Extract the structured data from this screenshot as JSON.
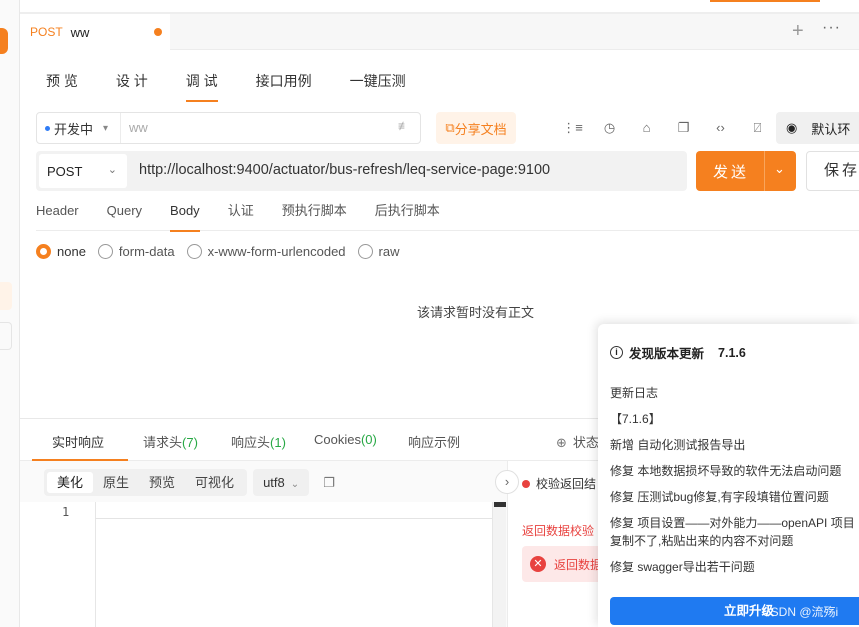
{
  "request_tab": {
    "method": "POST",
    "name": "ww"
  },
  "subtabs": [
    "预 览",
    "设 计",
    "调 试",
    "接口用例",
    "一键压测"
  ],
  "env": {
    "name": "开发中",
    "doc_placeholder": "ww",
    "share_label": "分享文档",
    "env_select": "默认环"
  },
  "request": {
    "method": "POST",
    "url": "http://localhost:9400/actuator/bus-refresh/leq-service-page:9100",
    "send_label": "发送",
    "save_label": "保存"
  },
  "request_tabs": [
    "Header",
    "Query",
    "Body",
    "认证",
    "预执行脚本",
    "后执行脚本"
  ],
  "body_types": [
    "none",
    "form-data",
    "x-www-form-urlencoded",
    "raw"
  ],
  "empty_body_text": "该请求暂时没有正文",
  "response": {
    "tabs": [
      {
        "label": "实时响应",
        "count": ""
      },
      {
        "label": "请求头",
        "count": "(7)"
      },
      {
        "label": "响应头",
        "count": "(1)"
      },
      {
        "label": "Cookies",
        "count": "(0)"
      },
      {
        "label": "响应示例",
        "count": ""
      }
    ],
    "status_label": "状态",
    "formats": [
      "美化",
      "原生",
      "预览",
      "可视化"
    ],
    "encoding": "utf8",
    "line_number": "1"
  },
  "verify": {
    "header": "校验返回结",
    "line": "返回数据校验",
    "error": "返回数据"
  },
  "update_popup": {
    "title": "发现版本更新",
    "version": "7.1.6",
    "lines": [
      "更新日志",
      "【7.1.6】",
      "新增 自动化测试报告导出",
      "修复 本地数据损坏导致的软件无法启动问题",
      "修复 压测试bug修复,有字段填错位置问题",
      "修复 项目设置——对外能力——openAPI 项目",
      "复制不了,粘贴出来的内容不对问题",
      "修复 swagger导出若干问题"
    ],
    "button_label": "立即升级",
    "watermark": "CSDN @流殇i"
  },
  "colors": {
    "accent": "#f5801f",
    "primary_blue": "#1f7af1",
    "error": "#e8423f",
    "success": "#27a844"
  }
}
